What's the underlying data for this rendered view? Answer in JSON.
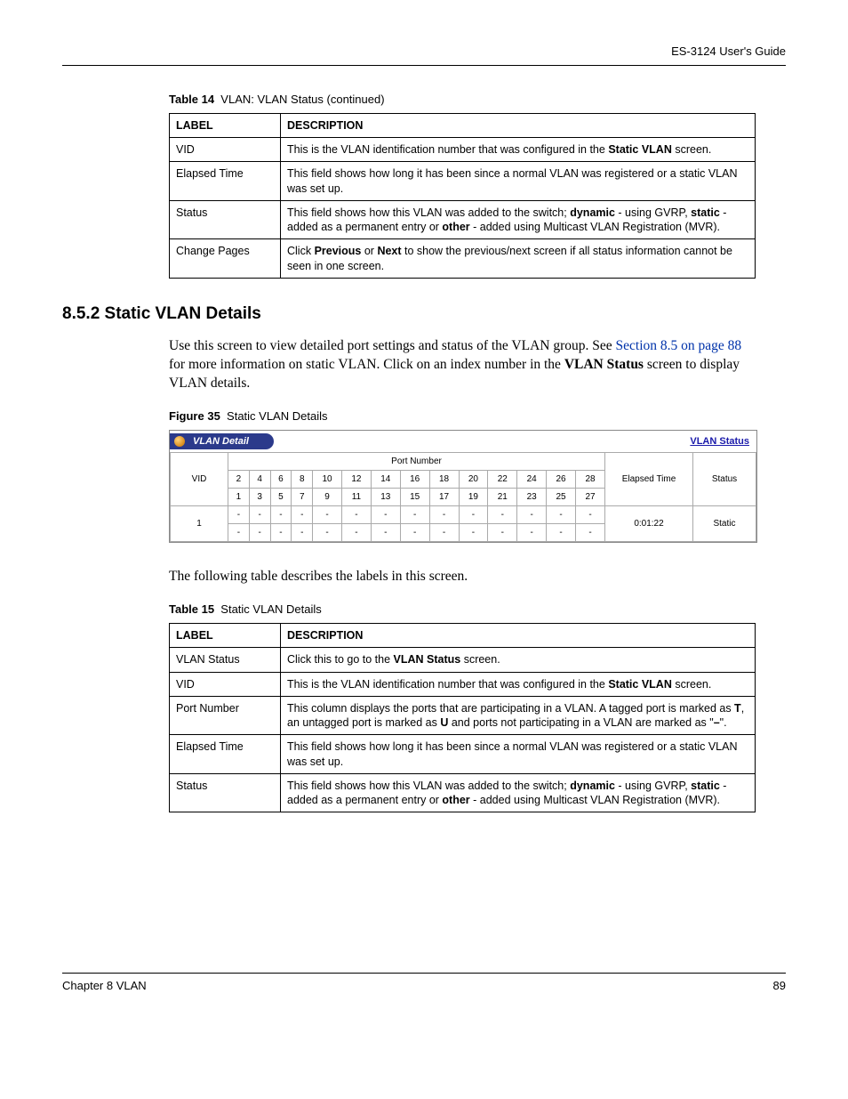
{
  "header": {
    "guide": "ES-3124 User's Guide"
  },
  "table14": {
    "caption_label": "Table 14",
    "caption_text": "VLAN: VLAN Status  (continued)",
    "cols": {
      "label": "LABEL",
      "desc": "DESCRIPTION"
    },
    "rows": {
      "r1": {
        "label": "VID",
        "desc_a": "This is the VLAN identification number that was configured in the ",
        "desc_b": "Static VLAN",
        "desc_c": " screen."
      },
      "r2": {
        "label": "Elapsed Time",
        "desc": "This field shows how long it has been since a normal VLAN was registered or a static VLAN was set up."
      },
      "r3": {
        "label": "Status",
        "desc_a": "This field shows how this VLAN was added to the switch; ",
        "desc_b": "dynamic",
        "desc_c": " - using GVRP, ",
        "desc_d": "static",
        "desc_e": " - added as a permanent entry or ",
        "desc_f": "other",
        "desc_g": " - added using Multicast VLAN Registration (MVR)."
      },
      "r4": {
        "label": "Change Pages",
        "desc_a": "Click ",
        "desc_b": "Previous",
        "desc_c": " or ",
        "desc_d": "Next",
        "desc_e": " to show the previous/next screen if all status information cannot be seen in one screen."
      }
    }
  },
  "section": {
    "heading": "8.5.2  Static VLAN Details",
    "para1_a": "Use this screen to view detailed port settings and status of the VLAN group. See ",
    "para1_link": "Section 8.5 on page 88",
    "para1_b": " for more information on static VLAN. Click on an index number in the ",
    "para1_bold": "VLAN Status",
    "para1_c": " screen to display VLAN details.",
    "para2": "The following table describes the labels in this screen."
  },
  "figure35": {
    "caption_label": "Figure 35",
    "caption_text": "Static VLAN Details",
    "tab_title": "VLAN Detail",
    "status_link": "VLAN Status",
    "headers": {
      "vid": "VID",
      "port": "Port Number",
      "elapsed": "Elapsed Time",
      "status": "Status"
    },
    "ports_top": [
      "2",
      "4",
      "6",
      "8",
      "10",
      "12",
      "14",
      "16",
      "18",
      "20",
      "22",
      "24",
      "26",
      "28"
    ],
    "ports_bottom": [
      "1",
      "3",
      "5",
      "7",
      "9",
      "11",
      "13",
      "15",
      "17",
      "19",
      "21",
      "23",
      "25",
      "27"
    ],
    "data": {
      "vid": "1",
      "row1": [
        "-",
        "-",
        "-",
        "-",
        "-",
        "-",
        "-",
        "-",
        "-",
        "-",
        "-",
        "-",
        "-",
        "-"
      ],
      "row2": [
        "-",
        "-",
        "-",
        "-",
        "-",
        "-",
        "-",
        "-",
        "-",
        "-",
        "-",
        "-",
        "-",
        "-"
      ],
      "elapsed": "0:01:22",
      "status": "Static"
    }
  },
  "table15": {
    "caption_label": "Table 15",
    "caption_text": "Static VLAN Details",
    "cols": {
      "label": "LABEL",
      "desc": "DESCRIPTION"
    },
    "rows": {
      "r1": {
        "label": "VLAN Status",
        "desc_a": "Click this to go to the ",
        "desc_b": "VLAN Status",
        "desc_c": " screen."
      },
      "r2": {
        "label": "VID",
        "desc_a": "This is the VLAN identification number that was configured in the ",
        "desc_b": "Static VLAN",
        "desc_c": " screen."
      },
      "r3": {
        "label": "Port Number",
        "desc_a": "This column displays the ports that are participating in a VLAN. A tagged port is marked as ",
        "desc_b": "T",
        "desc_c": ", an untagged port is marked as ",
        "desc_d": "U",
        "desc_e": " and ports not participating in a VLAN are marked as \"",
        "desc_f": "–",
        "desc_g": "\"."
      },
      "r4": {
        "label": "Elapsed Time",
        "desc": "This field shows how long it has been since a normal VLAN was registered or a static VLAN was set up."
      },
      "r5": {
        "label": "Status",
        "desc_a": "This field shows how this VLAN was added to the switch; ",
        "desc_b": "dynamic",
        "desc_c": " - using GVRP, ",
        "desc_d": "static",
        "desc_e": " - added as a permanent entry or ",
        "desc_f": "other",
        "desc_g": " - added using Multicast VLAN Registration (MVR)."
      }
    }
  },
  "footer": {
    "chapter": "Chapter 8 VLAN",
    "page": "89"
  }
}
